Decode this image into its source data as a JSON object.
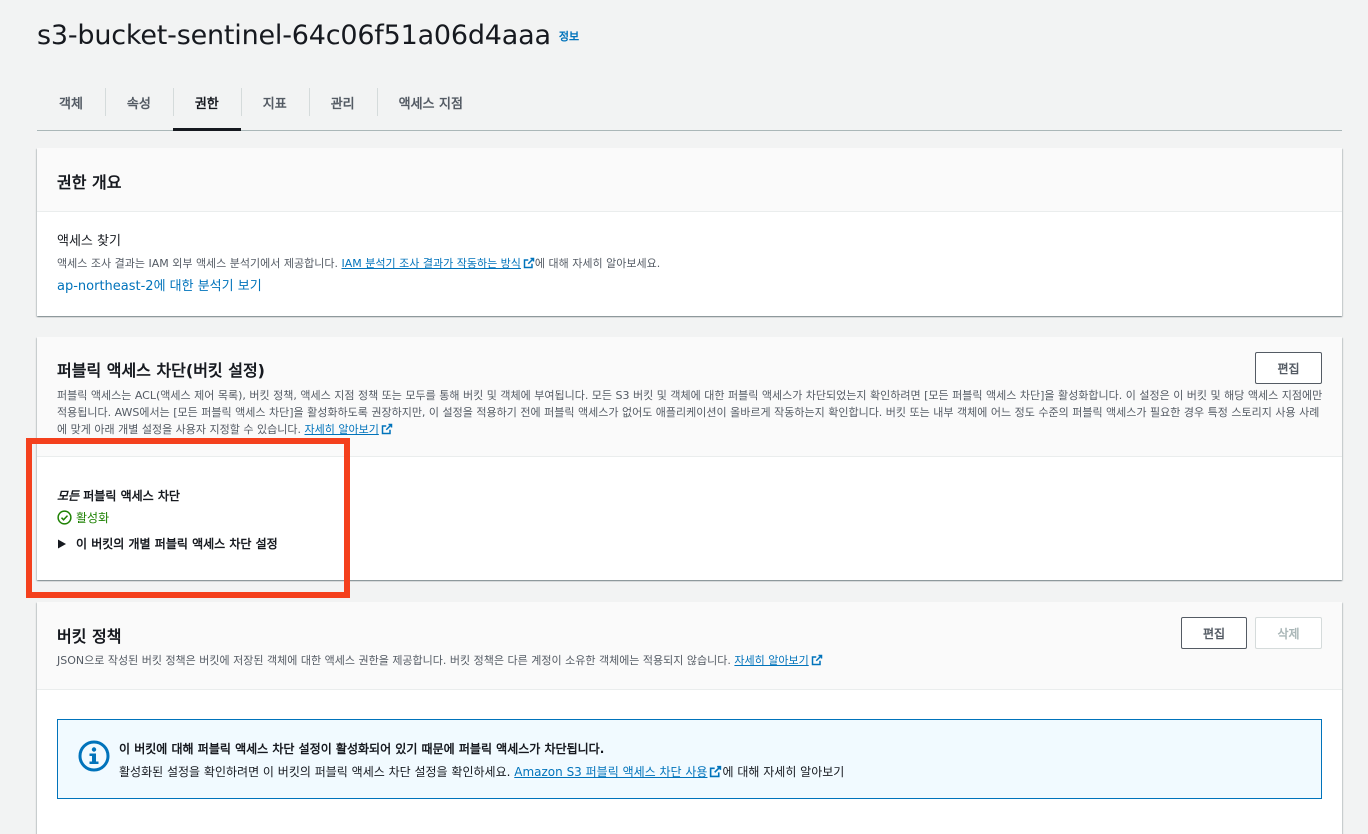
{
  "header": {
    "title": "s3-bucket-sentinel-64c06f51a06d4aaa",
    "info_label": "정보"
  },
  "tabs": [
    {
      "label": "객체",
      "active": false
    },
    {
      "label": "속성",
      "active": false
    },
    {
      "label": "권한",
      "active": true
    },
    {
      "label": "지표",
      "active": false
    },
    {
      "label": "관리",
      "active": false
    },
    {
      "label": "액세스 지점",
      "active": false
    }
  ],
  "overview": {
    "title": "권한 개요",
    "section_label": "액세스 찾기",
    "desc_prefix": "액세스 조사 결과는 IAM 외부 액세스 분석기에서 제공합니다. ",
    "desc_link": "IAM 분석기 조사 결과가 작동하는 방식",
    "desc_suffix": "에 대해 자세히 알아보세요.",
    "region_link": "ap-northeast-2에 대한 분석기 보기"
  },
  "public_access": {
    "title": "퍼블릭 액세스 차단(버킷 설정)",
    "edit_label": "편집",
    "desc": "퍼블릭 액세스는 ACL(액세스 제어 목록), 버킷 정책, 액세스 지점 정책 또는 모두를 통해 버킷 및 객체에 부여됩니다. 모든 S3 버킷 및 객체에 대한 퍼블릭 액세스가 차단되었는지 확인하려면 [모든 퍼블릭 액세스 차단]을 활성화합니다. 이 설정은 이 버킷 및 해당 액세스 지점에만 적용됩니다. AWS에서는 [모든 퍼블릭 액세스 차단]을 활성화하도록 권장하지만, 이 설정을 적용하기 전에 퍼블릭 액세스가 없어도 애플리케이션이 올바르게 작동하는지 확인합니다. 버킷 또는 내부 객체에 어느 정도 수준의 퍼블릭 액세스가 필요한 경우 특정 스토리지 사용 사례에 맞게 아래 개별 설정을 사용자 지정할 수 있습니다. ",
    "learn_more": "자세히 알아보기",
    "setting_emph": "모든",
    "setting_label": " 퍼블릭 액세스 차단",
    "status": "활성화",
    "status_color": "#1d8102",
    "expander_label": "이 버킷의 개별 퍼블릭 액세스 차단 설정"
  },
  "bucket_policy": {
    "title": "버킷 정책",
    "edit_label": "편집",
    "delete_label": "삭제",
    "desc": "JSON으로 작성된 버킷 정책은 버킷에 저장된 객체에 대한 액세스 권한을 제공합니다. 버킷 정책은 다른 계정이 소유한 객체에는 적용되지 않습니다. ",
    "learn_more": "자세히 알아보기",
    "alert_title": "이 버킷에 대해 퍼블릭 액세스 차단 설정이 활성화되어 있기 때문에 퍼블릭 액세스가 차단됩니다.",
    "alert_text": "활성화된 설정을 확인하려면 이 버킷의 퍼블릭 액세스 차단 설정을 확인하세요. ",
    "alert_link": "Amazon S3 퍼블릭 액세스 차단 사용",
    "alert_suffix": "에 대해 자세히 알아보기"
  },
  "colors": {
    "link": "#0073bb",
    "highlight_box": "#f4401d",
    "success": "#1d8102",
    "info": "#0073bb"
  }
}
